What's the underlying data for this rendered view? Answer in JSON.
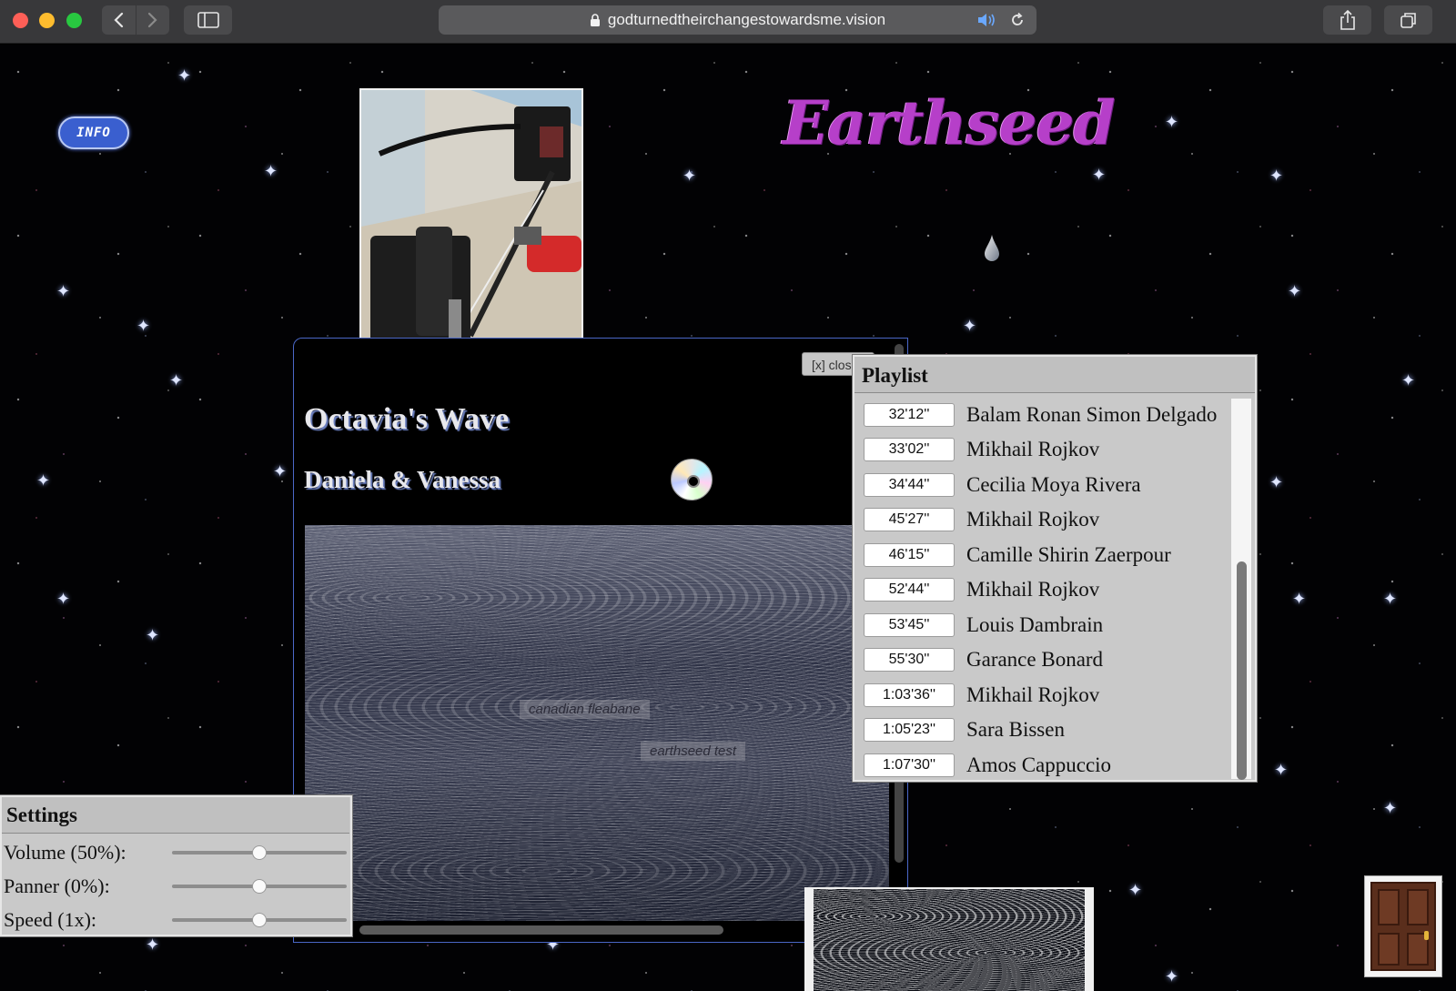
{
  "browser": {
    "url": "godturnedtheirchangestowardsme.vision"
  },
  "page": {
    "info_label": "INFO",
    "logo_text": "Earthseed",
    "player": {
      "close_label": "[x] close",
      "title": "Octavia's Wave",
      "artist": "Daniela & Vanessa",
      "video_tags": [
        "canadian fleabane",
        "earthseed test"
      ]
    },
    "playlist": {
      "header": "Playlist",
      "items": [
        {
          "time": "32'12''",
          "name": "Balam Ronan Simon Delgado"
        },
        {
          "time": "33'02''",
          "name": "Mikhail Rojkov"
        },
        {
          "time": "34'44''",
          "name": "Cecilia Moya Rivera"
        },
        {
          "time": "45'27''",
          "name": "Mikhail Rojkov"
        },
        {
          "time": "46'15''",
          "name": "Camille Shirin Zaerpour"
        },
        {
          "time": "52'44''",
          "name": "Mikhail Rojkov"
        },
        {
          "time": "53'45''",
          "name": "Louis Dambrain"
        },
        {
          "time": "55'30''",
          "name": "Garance Bonard"
        },
        {
          "time": "1:03'36''",
          "name": "Mikhail Rojkov"
        },
        {
          "time": "1:05'23''",
          "name": "Sara Bissen"
        },
        {
          "time": "1:07'30''",
          "name": "Amos Cappuccio"
        }
      ]
    },
    "settings": {
      "header": "Settings",
      "volume": {
        "label": "Volume (50%):",
        "value": 0.5
      },
      "panner": {
        "label": "Panner (0%):",
        "value": 0.5
      },
      "speed": {
        "label": "Speed (1x):",
        "value": 0.5
      }
    }
  },
  "colors": {
    "logo": "#b63fc9",
    "info_button": "#3a5fcf",
    "panel_bg": "#c9c9c9"
  }
}
